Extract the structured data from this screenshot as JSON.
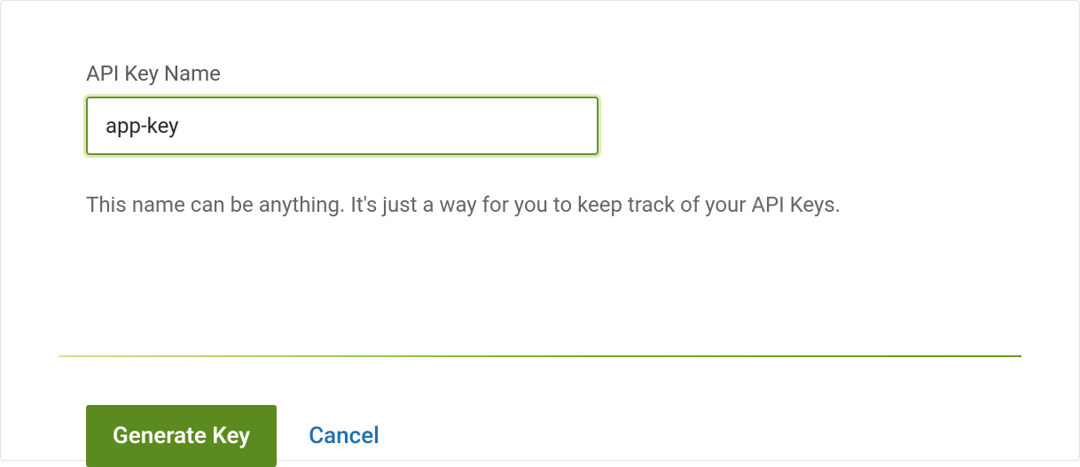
{
  "form": {
    "field_label": "API Key Name",
    "input_value": "app-key",
    "helper_text": "This name can be anything. It's just a way for you to keep track of your API Keys."
  },
  "actions": {
    "primary_label": "Generate Key",
    "cancel_label": "Cancel"
  },
  "colors": {
    "accent_green": "#5b8a1e",
    "link_blue": "#1f6fb2",
    "input_border": "#6d8f2e"
  }
}
